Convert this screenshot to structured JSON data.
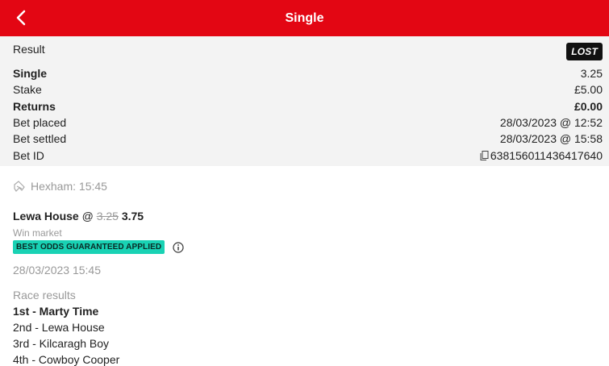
{
  "header": {
    "title": "Single"
  },
  "summary": {
    "result_label": "Result",
    "result_badge": "LOST",
    "bet_type_label": "Single",
    "bet_type_odds": "3.25",
    "stake_label": "Stake",
    "stake_value": "£5.00",
    "returns_label": "Returns",
    "returns_value": "£0.00",
    "placed_label": "Bet placed",
    "placed_value": "28/03/2023 @ 12:52",
    "settled_label": "Bet settled",
    "settled_value": "28/03/2023 @ 15:58",
    "betid_label": "Bet ID",
    "betid_value": "638156011436417640"
  },
  "selection": {
    "event": "Hexham: 15:45",
    "name": "Lewa House",
    "at": "@",
    "old_price": "3.25",
    "new_price": "3.75",
    "market": "Win market",
    "boost_badge": "BEST ODDS GUARANTEED APPLIED",
    "date": "28/03/2023 15:45"
  },
  "race_results": {
    "heading": "Race results",
    "items": [
      "1st - Marty Time",
      "2nd - Lewa House",
      "3rd - Kilcaragh Boy",
      "4th - Cowboy Cooper"
    ]
  },
  "colors": {
    "header_bg": "#e30613",
    "summary_bg": "#f3f3f3",
    "lost_badge_bg": "#111111",
    "boost_badge_bg": "#19d2b4"
  },
  "icons": {
    "back": "chevron-left-icon",
    "copy": "copy-icon",
    "event": "horse-racing-icon",
    "info": "info-icon"
  }
}
